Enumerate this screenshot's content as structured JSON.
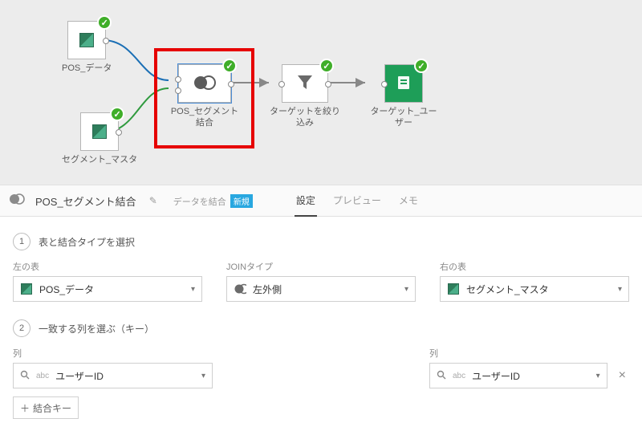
{
  "canvas": {
    "nodes": {
      "n1": {
        "label": "POS_データ",
        "type": "dataset"
      },
      "n2": {
        "label": "セグメント_マスタ",
        "type": "dataset"
      },
      "n3": {
        "label": "POS_セグメント結合",
        "type": "join"
      },
      "n4": {
        "label": "ターゲットを絞り込み",
        "type": "filter"
      },
      "n5": {
        "label": "ターゲット_ユーザー",
        "type": "output"
      }
    }
  },
  "panel": {
    "title": "POS_セグメント結合",
    "hint_label": "データを結合",
    "hint_badge": "新規",
    "tabs": {
      "settings": "設定",
      "preview": "プレビュー",
      "note": "メモ"
    }
  },
  "step1": {
    "title": "表と結合タイプを選択",
    "left_label": "左の表",
    "left_value": "POS_データ",
    "join_label": "JOINタイプ",
    "join_value": "左外側",
    "right_label": "右の表",
    "right_value": "セグメント_マスタ"
  },
  "step2": {
    "title": "一致する列を選ぶ（キー）",
    "col_label_left": "列",
    "col_label_right": "列",
    "left_key": "ユーザーID",
    "right_key": "ユーザーID",
    "add_key": "結合キー"
  }
}
